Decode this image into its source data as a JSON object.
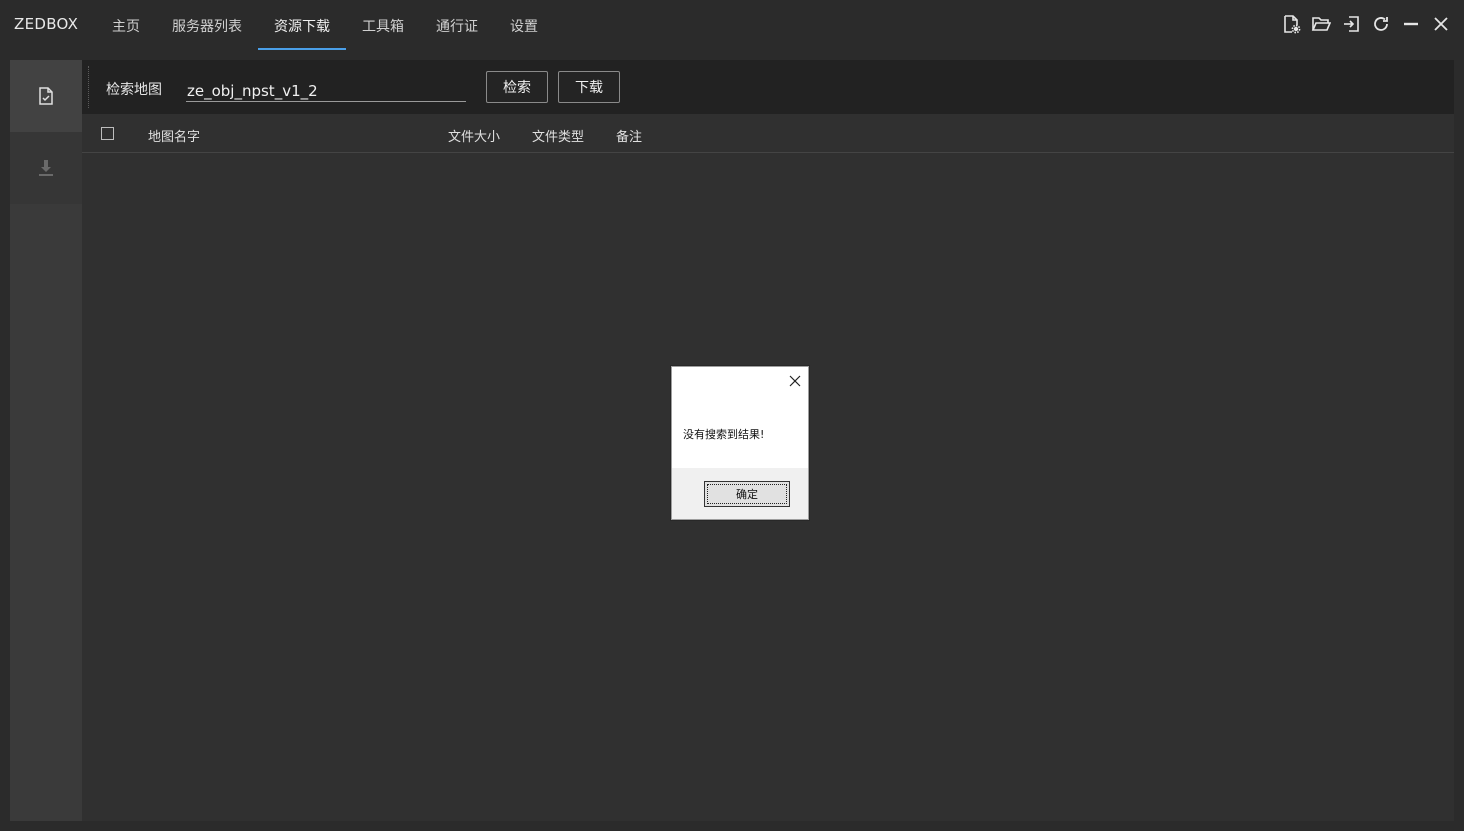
{
  "app": {
    "brand": "ZEDBOX"
  },
  "nav": {
    "items": [
      {
        "label": "主页"
      },
      {
        "label": "服务器列表"
      },
      {
        "label": "资源下载",
        "active": true
      },
      {
        "label": "工具箱"
      },
      {
        "label": "通行证"
      },
      {
        "label": "设置"
      }
    ]
  },
  "window_controls": [
    "file-settings-icon",
    "folder-open-icon",
    "sign-in-icon",
    "refresh-icon",
    "minimize-icon",
    "close-icon"
  ],
  "sidebar": {
    "items": [
      {
        "icon": "file-check-icon",
        "active": true
      },
      {
        "icon": "download-icon",
        "disabled": true
      }
    ]
  },
  "toolbar": {
    "search_label": "检索地图",
    "search_value": "ze_obj_npst_v1_2",
    "search_button": "检索",
    "download_button": "下载"
  },
  "table": {
    "columns": [
      "地图名字",
      "文件大小",
      "文件类型",
      "备注"
    ],
    "rows": []
  },
  "dialog": {
    "message": "没有搜索到结果!",
    "ok_label": "确定"
  },
  "colors": {
    "accent": "#4a9fe8",
    "background": "#2b2b2b",
    "toolbar": "#222222",
    "panel": "#303030"
  }
}
